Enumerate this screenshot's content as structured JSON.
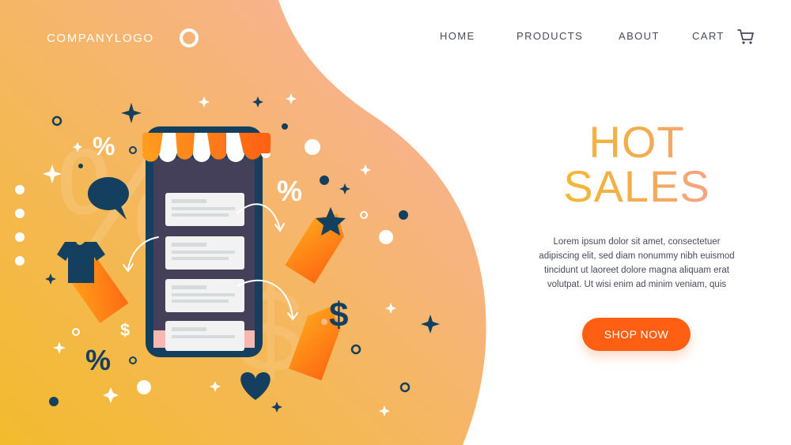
{
  "logo": {
    "text": "COMPANYLOGO"
  },
  "nav": {
    "items": [
      "HOME",
      "PRODUCTS",
      "ABOUT",
      "CART"
    ]
  },
  "hero": {
    "title_line1": "HOT",
    "title_line2": "SALES",
    "body_line1": "Lorem ipsum dolor sit amet, consectetuer",
    "body_line2": "adipiscing elit, sed diam nonummy nibh euismod",
    "body_line3": "tincidunt ut laoreet dolore magna aliquam erat",
    "body_line4": "volutpat. Ut wisi enim ad minim veniam, quis",
    "cta": "SHOP NOW"
  },
  "illustration": {
    "percent_symbol": "%",
    "dollar_symbol": "$"
  },
  "colors": {
    "bg_gradient_start": "#f2bb2d",
    "bg_gradient_end": "#f9b0a6",
    "navy": "#153f5f",
    "phone_body": "#45405a",
    "accent_orange": "#ff5f12",
    "tag_orange": "#ff8a16",
    "text_dark": "#4a4a5e"
  },
  "icons": [
    "logo-ring-icon",
    "cart-icon",
    "phone-illustration",
    "awning-icon",
    "tag-icon",
    "speech-bubble-icon",
    "tshirt-icon",
    "star-icon",
    "heart-icon",
    "dollar-icon",
    "percent-icon",
    "sparkle-icon"
  ]
}
